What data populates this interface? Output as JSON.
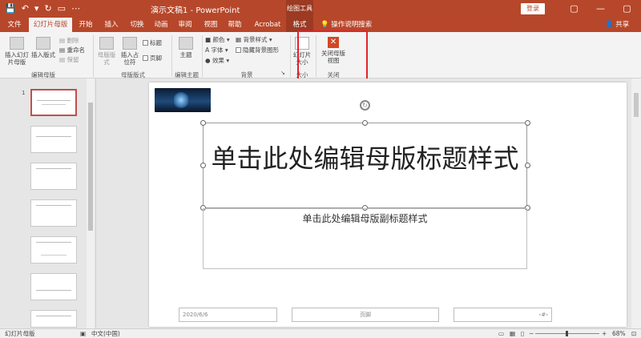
{
  "titlebar": {
    "doc_title": "演示文稿1 - PowerPoint",
    "tools_label": "绘图工具",
    "login": "登录",
    "qat": {
      "save": "💾",
      "undo": "↶",
      "undo_drop": "▾",
      "redo": "↻",
      "present": "▭",
      "more": "⋯"
    },
    "window": {
      "ribbon_opts": "▢",
      "minimize": "—",
      "maximize": "▢",
      "close": "✕"
    }
  },
  "tabs": [
    {
      "label": "文件"
    },
    {
      "label": "幻灯片母版"
    },
    {
      "label": "开始"
    },
    {
      "label": "插入"
    },
    {
      "label": "切换"
    },
    {
      "label": "动画"
    },
    {
      "label": "审阅"
    },
    {
      "label": "视图"
    },
    {
      "label": "帮助"
    },
    {
      "label": "Acrobat"
    },
    {
      "label": "格式"
    }
  ],
  "tellme": "操作说明搜索",
  "share": "共享",
  "ribbon": {
    "insert_master": "插入幻灯片母版",
    "insert_layout": "插入版式",
    "delete": "删除",
    "rename": "重命名",
    "preserve": "保留",
    "group_edit_master": "编辑母版",
    "master_layout": "母版版式",
    "insert_placeholder": "插入占位符",
    "title_chk": "标题",
    "footer_chk": "页脚",
    "group_master_layout": "母版版式",
    "themes": "主题",
    "group_edit_theme": "编辑主题",
    "colors": "颜色",
    "fonts": "字体",
    "effects": "效果",
    "bg_styles": "背景样式",
    "hide_bg": "隐藏背景图形",
    "group_background": "背景",
    "slide_size": "幻灯片大小",
    "group_size": "大小",
    "close_master": "关闭母版视图",
    "group_close": "关闭"
  },
  "thumbnails": [
    {
      "num": "1"
    },
    {
      "num": ""
    },
    {
      "num": ""
    },
    {
      "num": ""
    },
    {
      "num": ""
    },
    {
      "num": ""
    },
    {
      "num": ""
    }
  ],
  "slide": {
    "title": "单击此处编辑母版标题样式",
    "subtitle": "单击此处编辑母版副标题样式",
    "date": "2020/6/6",
    "footer": "页脚",
    "number": "‹#›"
  },
  "status": {
    "view": "幻灯片母版",
    "language": "中文(中国)",
    "zoom": "68%",
    "zoom_percent": 68
  },
  "colors": {
    "accent": "#b7472a",
    "highlight": "#e5202d"
  }
}
